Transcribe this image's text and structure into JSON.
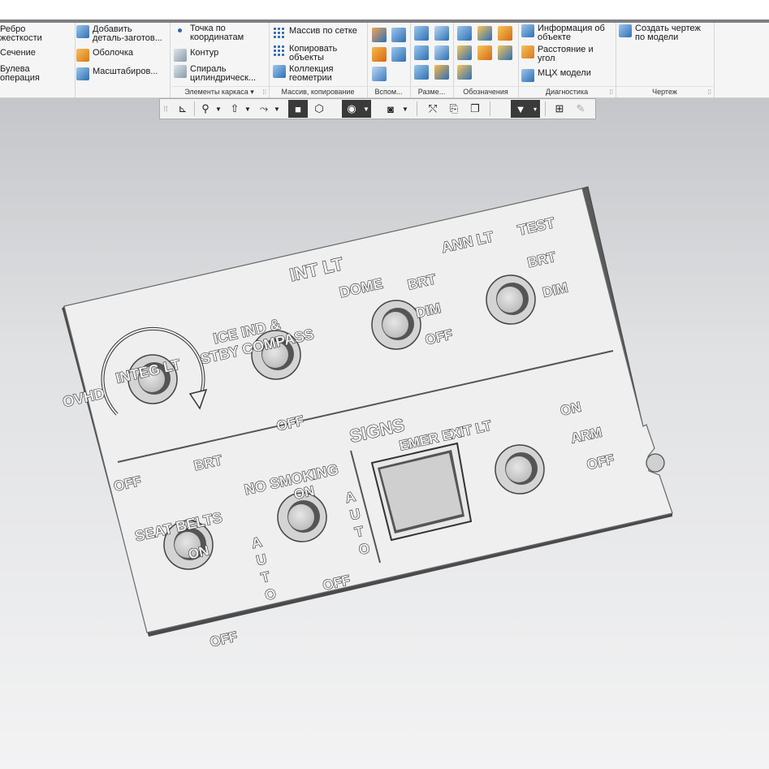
{
  "ribbon": {
    "col1": {
      "item1": "Ребро",
      "item1b": "жесткости",
      "item2": "Сечение",
      "item3": "Булева",
      "item3b": "операция"
    },
    "col2": {
      "item1": "Добавить",
      "item1b": "деталь-заготов...",
      "item2": "Оболочка",
      "item3": "Масштабиров..."
    },
    "frame": {
      "item1": "Точка по",
      "item1b": "координатам",
      "item2": "Контур",
      "item3": "Спираль",
      "item3b": "цилиндрическ...",
      "group": "Элементы каркаса"
    },
    "array": {
      "item1": "Массив по сетке",
      "item2": "Копировать",
      "item2b": "объекты",
      "item3": "Коллекция",
      "item3b": "геометрии",
      "group": "Массив, копирование"
    },
    "aux_group": "Вспом...",
    "dims_group": "Разме...",
    "notation_group": "Обозначения",
    "diag": {
      "item1": "Информация об",
      "item1b": "объекте",
      "item2": "Расстояние и",
      "item2b": "угол",
      "item3": "МЦХ модели",
      "group": "Диагностика"
    },
    "drawing": {
      "item1": "Создать чертеж",
      "item1b": "по модели",
      "group": "Чертеж"
    }
  },
  "icons": {
    "toolbar": [
      "grip-icon",
      "orient-icon",
      "zoom-icon",
      "pan-icon",
      "rotate-icon",
      "shaded-icon",
      "wireframe-icon",
      "hide-icon",
      "display-mode-icon",
      "relations-icon",
      "clipboard-icon",
      "layers-icon",
      "filter-icon",
      "properties-icon",
      "pen-icon"
    ]
  },
  "panel": {
    "int_lt": "INT LT",
    "ovhd": "OVHD",
    "integ_lt": "INTEG  LT",
    "ice_ind_1": "ICE IND &",
    "ice_ind_2": "STBY COMPASS",
    "dome": "DOME",
    "ann_lt": "ANN LT",
    "test": "TEST",
    "brt_a": "BRT",
    "dim_a": "DIM",
    "off_a": "OFF",
    "brt_b": "BRT",
    "dim_b": "DIM",
    "off_ovhd": "OFF",
    "brt_ovhd": "BRT",
    "off_ice": "OFF",
    "signs": "SIGNS",
    "seat_belts": "SEAT BELTS",
    "no_smoking": "NO SMOKING",
    "emer_exit": "EMER EXIT LT",
    "on_seat": "ON",
    "off_seat": "OFF",
    "on_nosmk": "ON",
    "off_nosmk": "OFF",
    "auto_1": [
      "A",
      "U",
      "T",
      "O"
    ],
    "auto_2": [
      "A",
      "U",
      "T",
      "O"
    ],
    "on_emer": "ON",
    "arm_emer": "ARM",
    "off_emer": "OFF"
  },
  "colors": {
    "panel_face": "#efefef",
    "panel_edge": "#4a4a4a",
    "background_top": "#b9bbbe",
    "background_bottom": "#f3f3f4"
  }
}
